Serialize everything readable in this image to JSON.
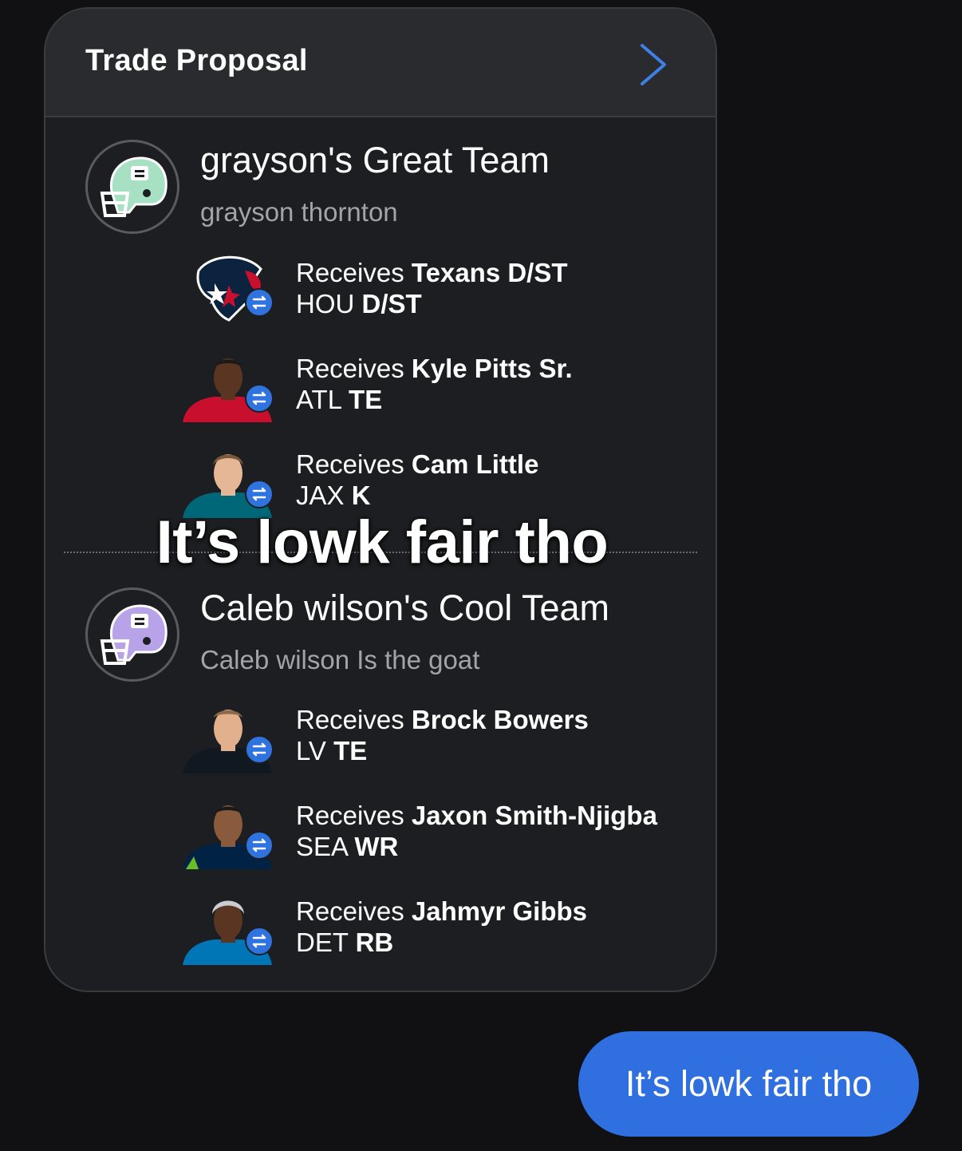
{
  "trade_card": {
    "title": "Trade Proposal",
    "chevron_icon": "chevron-right-icon",
    "teams": [
      {
        "name": "grayson's Great Team",
        "owner": "grayson thornton",
        "logo_icon": "football-helmet-icon",
        "helmet_color": "#a8e0c4",
        "players": [
          {
            "receives": "Receives",
            "player": "Texans D/ST",
            "team": "HOU",
            "position": "D/ST",
            "jersey": "#0c2340"
          },
          {
            "receives": "Receives",
            "player": "Kyle Pitts Sr.",
            "team": "ATL",
            "position": "TE",
            "jersey": "#c8102e"
          },
          {
            "receives": "Receives",
            "player": "Cam Little",
            "team": "JAX",
            "position": "K",
            "jersey": "#006778"
          }
        ]
      },
      {
        "name": "Caleb wilson's Cool Team",
        "owner": "Caleb wilson Is the goat",
        "logo_icon": "football-helmet-icon",
        "helmet_color": "#b9a3e8",
        "players": [
          {
            "receives": "Receives",
            "player": "Brock Bowers",
            "team": "LV",
            "position": "TE",
            "jersey": "#101820"
          },
          {
            "receives": "Receives",
            "player": "Jaxon Smith-Njigba",
            "team": "SEA",
            "position": "WR",
            "jersey": "#002244"
          },
          {
            "receives": "Receives",
            "player": "Jahmyr Gibbs",
            "team": "DET",
            "position": "RB",
            "jersey": "#0076b6"
          }
        ]
      }
    ]
  },
  "overlay_caption": "It’s lowk fair tho",
  "message_bubble": "It’s lowk fair tho",
  "colors": {
    "background": "#111113",
    "card": "#1d1e21",
    "card_header": "#2a2b2e",
    "accent_blue": "#2f6fdf"
  }
}
